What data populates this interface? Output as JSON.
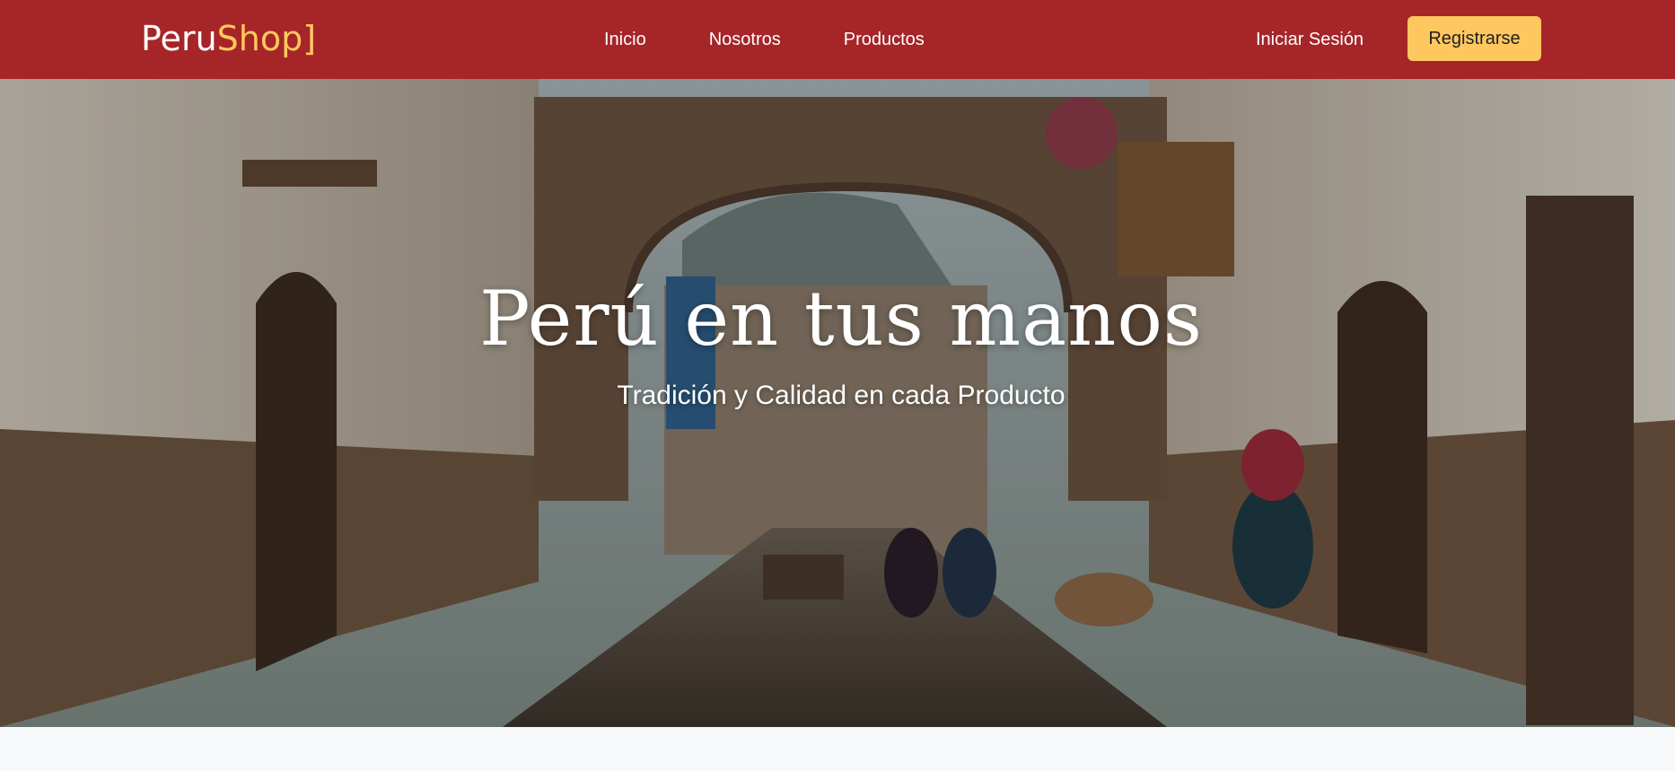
{
  "navbar": {
    "brand_main": "Peru",
    "brand_accent": "Shop]",
    "links": [
      {
        "label": "Inicio"
      },
      {
        "label": "Nosotros"
      },
      {
        "label": "Productos"
      }
    ],
    "login_label": "Iniciar Sesión",
    "register_label": "Registrarse"
  },
  "hero": {
    "title": "Perú en tus manos",
    "subtitle": "Tradición y Calidad en cada Producto"
  },
  "colors": {
    "navbar_bg": "#a62528",
    "accent": "#ffc75f",
    "page_bg": "#f8f9fb"
  }
}
